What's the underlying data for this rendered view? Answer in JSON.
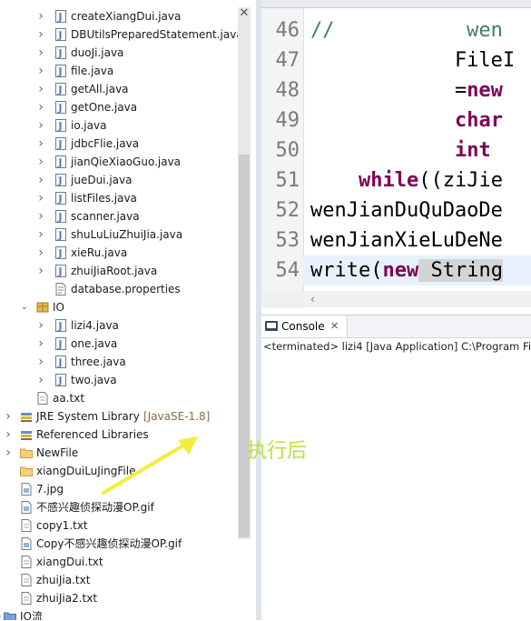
{
  "explorer": {
    "java_files_1": [
      "createXiangDui.java",
      "DBUtilsPreparedStatement.java",
      "duoJi.java",
      "file.java",
      "getAll.java",
      "getOne.java",
      "io.java",
      "jdbcFlie.java",
      "jianQieXiaoGuo.java",
      "jueDui.java",
      "listFiles.java",
      "scanner.java",
      "shuLuLiuZhuiJia.java",
      "xieRu.java",
      "zhuiJiaRoot.java"
    ],
    "properties_file": "database.properties",
    "io_package": "IO",
    "io_files": [
      "lizi4.java",
      "one.java",
      "three.java",
      "two.java"
    ],
    "aa_file": "aa.txt",
    "jre_label": "JRE System Library",
    "jre_version": "[JavaSE-1.8]",
    "referenced_libraries": "Referenced Libraries",
    "newfile_folder": "NewFile",
    "xiangdui_folder": "xiangDuiLuJingFile",
    "root_files": [
      "7.jpg",
      "不感兴趣侦探动漫OP.gif",
      "copy1.txt",
      "Copy不感兴趣侦探动漫OP.gif",
      "xiangDui.txt",
      "zhuiJia.txt",
      "zhuiJia2.txt"
    ],
    "bottom_project": "IO流",
    "close_glyph": "✕"
  },
  "editor": {
    "line_numbers": [
      "46",
      "47",
      "48",
      "49",
      "50",
      "51",
      "52",
      "53",
      "54"
    ],
    "lines": [
      {
        "a": "//           wen",
        "b": ""
      },
      {
        "a": "            FileI",
        "b": ""
      },
      {
        "a": "            =",
        "b": "new"
      },
      {
        "a": "            ",
        "b": "char"
      },
      {
        "a": "            ",
        "b": "int"
      },
      {
        "a": "    ",
        "b": "while",
        "c": "((ziJie"
      },
      {
        "a": "wenJianDuQuDaoDe",
        "b": ""
      },
      {
        "a": "wenJianXieLuDeNe",
        "b": ""
      },
      {
        "a": "write(",
        "b": "new",
        "c": " String"
      }
    ]
  },
  "console": {
    "tab_label": "Console",
    "close_glyph": "✕",
    "status": "<terminated> lizi4 [Java Application] C:\\Program Fi"
  },
  "annotation": "执行后",
  "colors": {
    "keyword": "#7f0055",
    "comment": "#3f7f5f",
    "annotation": "#b8e23c",
    "arrow": "#f2ee3a"
  }
}
